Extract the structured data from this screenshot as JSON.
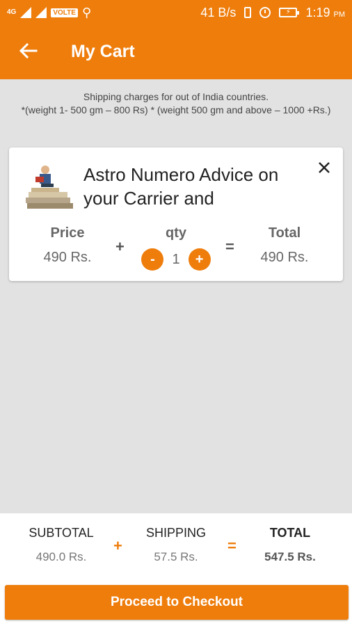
{
  "status_bar": {
    "network": "4G",
    "volte": "VOLTE",
    "speed": "41 B/s",
    "time": "1:19",
    "ampm": "PM"
  },
  "app_bar": {
    "title": "My Cart"
  },
  "notice": {
    "line1": "Shipping charges for out of India countries.",
    "line2": "*(weight 1- 500 gm – 800 Rs) * (weight 500 gm and above – 1000 +Rs.)"
  },
  "cart_item": {
    "name": "Astro Numero Advice on your Carrier and",
    "price_label": "Price",
    "price": "490 Rs.",
    "qty_label": "qty",
    "qty": "1",
    "minus": "-",
    "plus": "+",
    "total_label": "Total",
    "total": "490 Rs.",
    "op_plus": "+",
    "op_equals": "="
  },
  "summary": {
    "subtotal_label": "SUBTOTAL",
    "subtotal": "490.0 Rs.",
    "shipping_label": "SHIPPING",
    "shipping": "57.5 Rs.",
    "total_label": "TOTAL",
    "total": "547.5 Rs.",
    "op_plus": "+",
    "op_equals": "="
  },
  "checkout_label": "Proceed to Checkout",
  "colors": {
    "accent": "#ee7d0c",
    "background": "#e2e2e2"
  },
  "icons": [
    "arrow-back-icon",
    "close-icon",
    "usb-icon",
    "vibrate-icon",
    "alarm-icon",
    "battery-icon",
    "signal-icon"
  ]
}
